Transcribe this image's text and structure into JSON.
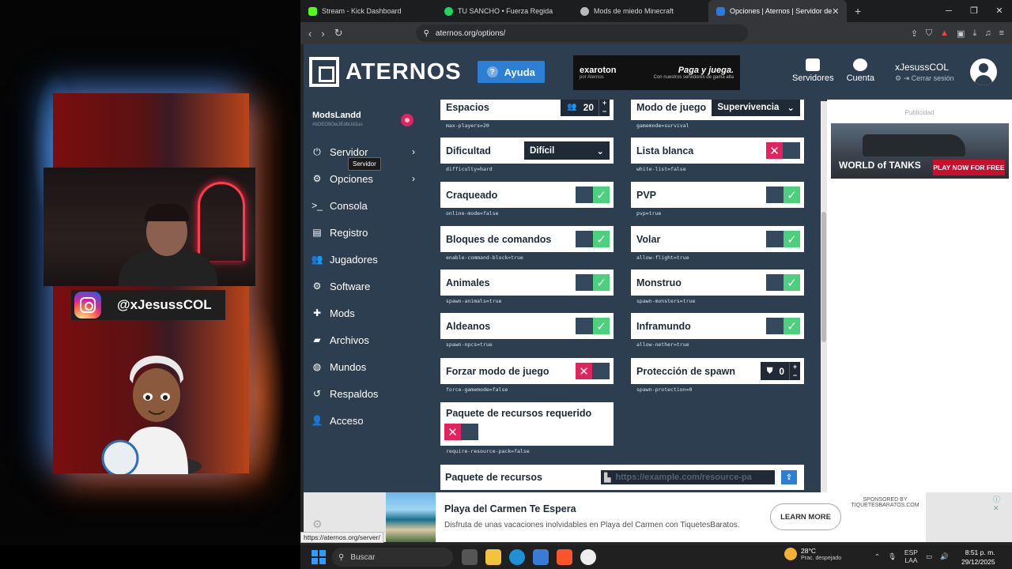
{
  "overlay": {
    "instagram_handle": "@xJesussCOL"
  },
  "browser": {
    "tabs": [
      {
        "label": "Stream - Kick Dashboard",
        "color": "#53fc18"
      },
      {
        "label": "TU SANCHO • Fuerza Regida",
        "color": "#1ed760"
      },
      {
        "label": "Mods de miedo Minecraft",
        "color": "#bbbbbb"
      },
      {
        "label": "Opciones | Aternos | Servidor de",
        "color": "#2c7ad6"
      }
    ],
    "url": "aternos.org/options/",
    "status_url": "https://aternos.org/server/"
  },
  "header": {
    "logo": "ATERNOS",
    "help": "Ayuda",
    "ad_brand": "exaroton",
    "ad_brand_sub": "por Aternos",
    "ad_slogan": "Paga y juega.",
    "ad_slogan_sub": "Con nuestros servidores de gama alta",
    "nav_servers": "Servidores",
    "nav_account": "Cuenta",
    "username": "xJesussCOL",
    "logout": "Cerrar sesión"
  },
  "sidebar": {
    "server_name": "ModsLandd",
    "server_id": "#bOEO9OwJEdbUd1uo",
    "tooltip": "Servidor",
    "items": [
      {
        "label": "Servidor",
        "icon": "power-icon",
        "glyph": "⏻",
        "chevron": true
      },
      {
        "label": "Opciones",
        "icon": "sliders-icon",
        "glyph": "⚙",
        "chevron": true
      },
      {
        "label": "Consola",
        "icon": "terminal-icon",
        "glyph": ">_",
        "chevron": false
      },
      {
        "label": "Registro",
        "icon": "log-icon",
        "glyph": "▤",
        "chevron": false
      },
      {
        "label": "Jugadores",
        "icon": "users-icon",
        "glyph": "👥",
        "chevron": false
      },
      {
        "label": "Software",
        "icon": "cogs-icon",
        "glyph": "⚙",
        "chevron": false
      },
      {
        "label": "Mods",
        "icon": "puzzle-icon",
        "glyph": "✚",
        "chevron": false
      },
      {
        "label": "Archivos",
        "icon": "folder-icon",
        "glyph": "▰",
        "chevron": false
      },
      {
        "label": "Mundos",
        "icon": "globe-icon",
        "glyph": "◍",
        "chevron": false
      },
      {
        "label": "Respaldos",
        "icon": "backup-icon",
        "glyph": "↺",
        "chevron": false
      },
      {
        "label": "Acceso",
        "icon": "user-plus-icon",
        "glyph": "👤",
        "chevron": false
      }
    ]
  },
  "options": {
    "max_players": {
      "label": "Espacios",
      "value": "20",
      "key": "max-players=20"
    },
    "gamemode": {
      "label": "Modo de juego",
      "value": "Supervivencia",
      "key": "gamemode=survival"
    },
    "difficulty": {
      "label": "Dificultad",
      "value": "Difícil",
      "key": "difficulty=hard"
    },
    "whitelist": {
      "label": "Lista blanca",
      "key": "white-list=false",
      "on": false
    },
    "online_mode": {
      "label": "Craqueado",
      "key": "online-mode=false",
      "on": true
    },
    "pvp": {
      "label": "PVP",
      "key": "pvp=true",
      "on": true
    },
    "command_blocks": {
      "label": "Bloques de comandos",
      "key": "enable-command-block=true",
      "on": true
    },
    "flight": {
      "label": "Volar",
      "key": "allow-flight=true",
      "on": true
    },
    "animals": {
      "label": "Animales",
      "key": "spawn-animals=true",
      "on": true
    },
    "monsters": {
      "label": "Monstruo",
      "key": "spawn-monsters=true",
      "on": true
    },
    "npcs": {
      "label": "Aldeanos",
      "key": "spawn-npcs=true",
      "on": true
    },
    "nether": {
      "label": "Inframundo",
      "key": "allow-nether=true",
      "on": true
    },
    "force_gamemode": {
      "label": "Forzar modo de juego",
      "key": "force-gamemode=false",
      "on": false
    },
    "spawn_protection": {
      "label": "Protección de spawn",
      "value": "0",
      "key": "spawn-protection=0"
    },
    "require_pack": {
      "label": "Paquete de recursos requerido",
      "key": "require-resource-pack=false",
      "on": false
    },
    "resource_pack": {
      "label": "Paquete de recursos",
      "placeholder": "https://example.com/resource-pa"
    }
  },
  "right_ad": {
    "label": "Publicidad",
    "game": "WORLD of TANKS",
    "cta": "PLAY NOW FOR FREE"
  },
  "bottom_ad": {
    "title": "Playa del Carmen Te Espera",
    "desc": "Disfruta de unas vacaciones inolvidables en Playa del Carmen con TiquetesBaratos.",
    "button": "LEARN MORE",
    "sponsor_line1": "SPONSORED BY",
    "sponsor_line2": "TIQUETESBARATOS.COM"
  },
  "taskbar": {
    "search": "Buscar",
    "temp": "28°C",
    "weather": "Prac. despejado",
    "lang1": "ESP",
    "lang2": "LAA",
    "time": "8:51 p. m.",
    "date": "29/12/2025"
  }
}
